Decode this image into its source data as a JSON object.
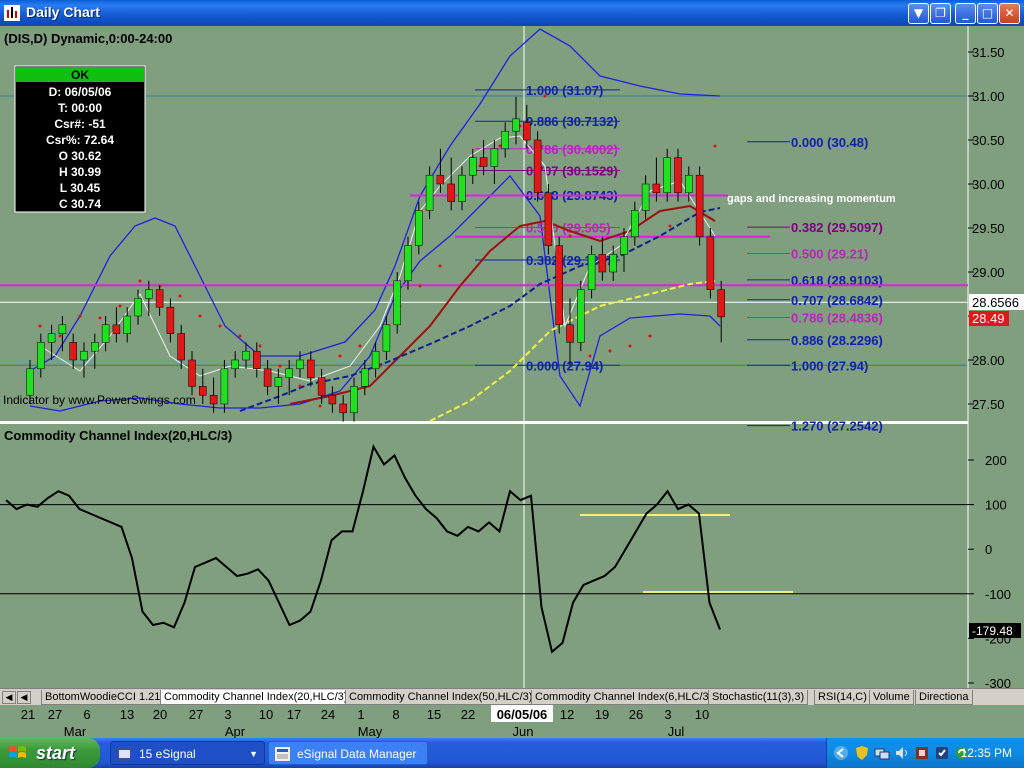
{
  "window": {
    "title": "Daily Chart",
    "buttons": {
      "dropdown": "▼",
      "restore": "❐",
      "minimize": "_",
      "maximize": "□",
      "close": "✕"
    }
  },
  "chart": {
    "header": "(DIS,D) Dynamic,0:00-24:00",
    "cursor_box": {
      "status": "OK",
      "rows": [
        "D: 06/05/06",
        "T: 00:00",
        "Csr#: -51",
        "Csr%: 72.64",
        "O 30.62",
        "H 30.99",
        "L 30.45",
        "C 30.74"
      ]
    },
    "price_axis": {
      "labels": [
        "31.50",
        "31.00",
        "30.50",
        "30.00",
        "29.50",
        "29.00",
        "28.50",
        "28.00",
        "27.50"
      ],
      "values": [
        31.5,
        31.0,
        30.5,
        30.0,
        29.5,
        29.0,
        28.5,
        28.0,
        27.5
      ],
      "current_price": "28.6566",
      "last_close": "28.49"
    },
    "fib_left": [
      {
        "label": "1.000 (31.07)",
        "value": 31.07,
        "color": "#1020b0"
      },
      {
        "label": "0.886 (30.7132)",
        "value": 30.7132,
        "color": "#1020b0"
      },
      {
        "label": "0.786 (30.4002)",
        "value": 30.4002,
        "color": "#c020c0"
      },
      {
        "label": "0.707 (30.1529)",
        "value": 30.1529,
        "color": "#800080"
      },
      {
        "label": "0.618 (29.8743)",
        "value": 29.8743,
        "color": "#1020b0"
      },
      {
        "label": "0.500 (29.505)",
        "value": 29.505,
        "color": "#c020c0"
      },
      {
        "label": "0.382 (29.1357)",
        "value": 29.1357,
        "color": "#1020b0"
      },
      {
        "label": "0.000 (27.94)",
        "value": 27.94,
        "color": "#1020b0"
      }
    ],
    "fib_right": [
      {
        "label": "0.000 (30.48)",
        "value": 30.48,
        "color": "#1020b0"
      },
      {
        "label": "0.382 (29.5097)",
        "value": 29.5097,
        "color": "#800080"
      },
      {
        "label": "0.500 (29.21)",
        "value": 29.21,
        "color": "#c020c0"
      },
      {
        "label": "0.618 (28.9103)",
        "value": 28.9103,
        "color": "#1020b0"
      },
      {
        "label": "0.707 (28.6842)",
        "value": 28.6842,
        "color": "#1020b0"
      },
      {
        "label": "0.786 (28.4836)",
        "value": 28.4836,
        "color": "#c020c0"
      },
      {
        "label": "0.886 (28.2296)",
        "value": 28.2296,
        "color": "#1020b0"
      },
      {
        "label": "1.000 (27.94)",
        "value": 27.94,
        "color": "#1020b0"
      },
      {
        "label": "1.270 (27.2542)",
        "value": 27.2542,
        "color": "#1020b0"
      }
    ],
    "annotation": "gaps and increasing momentum",
    "credit": "Indicator by www.PowerSwings.com",
    "cci_title": "Commodity Channel Index(20,HLC/3)",
    "cci_axis": {
      "labels": [
        "200",
        "100",
        "0",
        "-100",
        "-200",
        "-300"
      ],
      "values": [
        200,
        100,
        0,
        -100,
        -200,
        -300
      ],
      "current": "-179.48"
    },
    "date_axis": {
      "days": [
        "21",
        "27",
        "6",
        "13",
        "20",
        "27",
        "3",
        "10",
        "17",
        "24",
        "1",
        "8",
        "15",
        "22",
        "06/05/06",
        "12",
        "19",
        "26",
        "3",
        "10"
      ],
      "months": [
        "Mar",
        "Apr",
        "May",
        "Jun",
        "Jul"
      ]
    },
    "colors": {
      "background": "#7f9f7f",
      "magenta": "#e020e0",
      "bollinger": "#2020e0",
      "ma_red": "#a01010",
      "ma_navy": "#102090",
      "ma_yellow": "#f0f040",
      "sar": "#e01010",
      "up": "#20e020",
      "down": "#e01818"
    }
  },
  "chart_data": [
    {
      "type": "line",
      "title": "(DIS,D) Dynamic,0:00-24:00",
      "series": [
        {
          "name": "DIS daily close",
          "x": [
            "Mar 21",
            "Mar 27",
            "Apr 6",
            "Apr 13",
            "Apr 20",
            "Apr 27",
            "May 3",
            "May 10",
            "May 17",
            "May 24",
            "Jun 1",
            "Jun 5",
            "Jun 8",
            "Jun 12",
            "Jun 15",
            "Jun 19",
            "Jun 22",
            "Jun 26",
            "Jul 3",
            "Jul 6",
            "Jul 10",
            "Jul 11"
          ],
          "values": [
            28.2,
            28.4,
            28.3,
            28.8,
            27.8,
            28.0,
            27.8,
            27.5,
            28.2,
            28.9,
            29.8,
            30.74,
            29.4,
            28.4,
            28.9,
            29.2,
            29.3,
            29.9,
            30.0,
            30.0,
            28.7,
            28.49
          ]
        }
      ],
      "ylim": [
        27.3,
        31.7
      ]
    },
    {
      "type": "line",
      "title": "Commodity Channel Index(20,HLC/3)",
      "series": [
        {
          "name": "CCI(20,HLC/3)",
          "x": [
            "Mar 21",
            "Mar 27",
            "Apr 6",
            "Apr 13",
            "Apr 20",
            "Apr 27",
            "May 3",
            "May 10",
            "May 17",
            "May 24",
            "Jun 1",
            "Jun 5",
            "Jun 8",
            "Jun 12",
            "Jun 15",
            "Jun 19",
            "Jun 22",
            "Jun 26",
            "Jul 3",
            "Jul 6",
            "Jul 10",
            "Jul 11"
          ],
          "values": [
            100,
            140,
            110,
            120,
            -140,
            -160,
            -80,
            -20,
            -180,
            -150,
            50,
            140,
            120,
            -230,
            -90,
            -60,
            -40,
            50,
            130,
            90,
            -120,
            -179.48
          ]
        }
      ],
      "ylim": [
        -300,
        250
      ]
    }
  ],
  "tabs": {
    "items": [
      "BottomWoodieCCI 1.21",
      "Commodity Channel Index(20,HLC/3)",
      "Commodity Channel Index(50,HLC/3)",
      "Commodity Channel Index(6,HLC/3)",
      "Stochastic(11(3),3)",
      "RSI(14,C)",
      "Volume",
      "Directiona"
    ],
    "active_index": 1
  },
  "taskbar": {
    "start": "start",
    "buttons": [
      {
        "label": "15 eSignal",
        "icon": "esignal-icon"
      },
      {
        "label": "eSignal Data Manager",
        "icon": "data-manager-icon"
      }
    ],
    "clock": "12:35 PM",
    "tray_icons": [
      "back-arrow-icon",
      "shield-icon",
      "network-icon",
      "volume-icon",
      "app-tray-icon",
      "security-icon",
      "sync-icon"
    ]
  }
}
